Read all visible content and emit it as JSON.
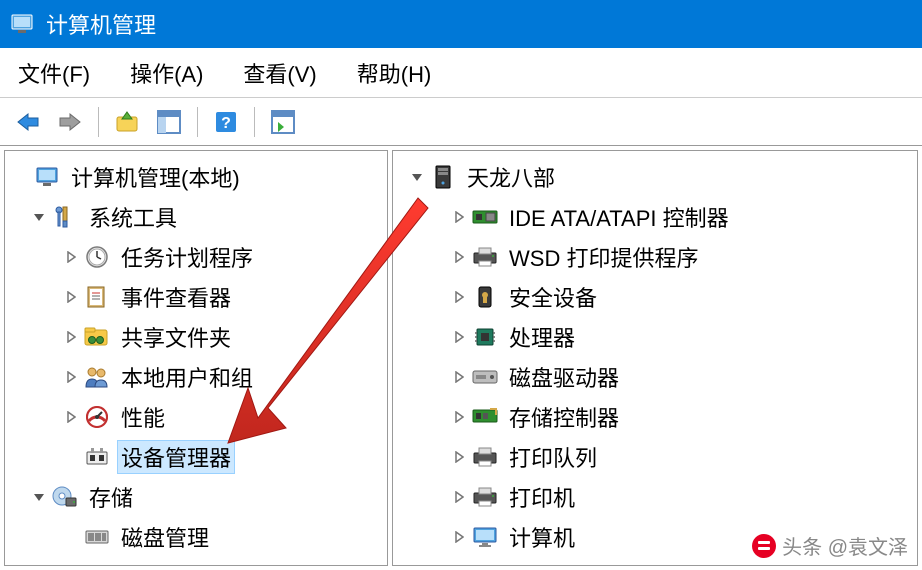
{
  "window": {
    "title": "计算机管理"
  },
  "menu": {
    "file": "文件(F)",
    "action": "操作(A)",
    "view": "查看(V)",
    "help": "帮助(H)"
  },
  "left_tree": {
    "root": "计算机管理(本地)",
    "system_tools": "系统工具",
    "task_scheduler": "任务计划程序",
    "event_viewer": "事件查看器",
    "shared_folders": "共享文件夹",
    "local_users_groups": "本地用户和组",
    "performance": "性能",
    "device_manager": "设备管理器",
    "storage": "存储",
    "disk_management": "磁盘管理"
  },
  "right_tree": {
    "root": "天龙八部",
    "ide": "IDE ATA/ATAPI 控制器",
    "wsd": "WSD 打印提供程序",
    "security": "安全设备",
    "processors": "处理器",
    "disk_drives": "磁盘驱动器",
    "storage_controllers": "存储控制器",
    "print_queues": "打印队列",
    "printers": "打印机",
    "computer": "计算机"
  },
  "watermark": {
    "text": "头条 @袁文泽"
  }
}
